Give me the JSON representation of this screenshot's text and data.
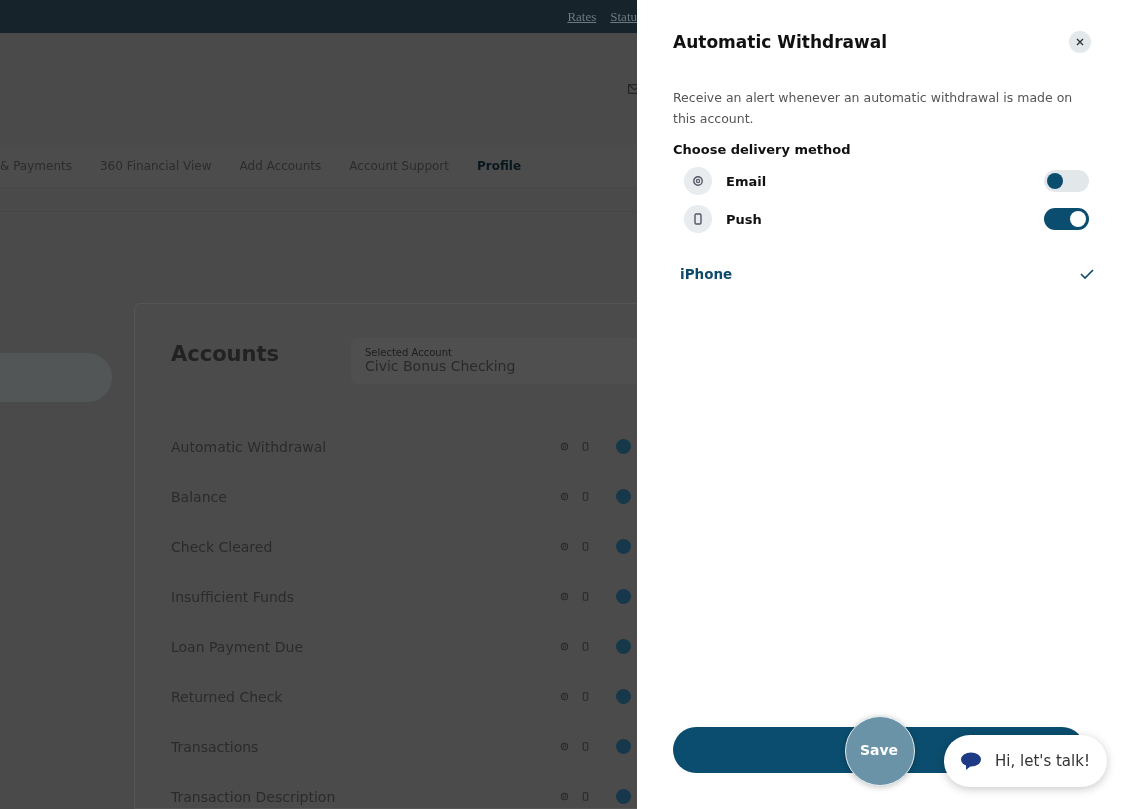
{
  "top_links": [
    "Rates",
    "Statu"
  ],
  "nav": [
    {
      "label": "& Payments",
      "selected": false
    },
    {
      "label": "360 Financial View",
      "selected": false
    },
    {
      "label": "Add Accounts",
      "selected": false
    },
    {
      "label": "Account Support",
      "selected": false
    },
    {
      "label": "Profile",
      "selected": true
    }
  ],
  "accounts": {
    "title": "Accounts",
    "selector": {
      "label": "Selected Account",
      "value": "Civic Bonus Checking"
    },
    "alerts": [
      "Automatic Withdrawal",
      "Balance",
      "Check Cleared",
      "Insufficient Funds",
      "Loan Payment Due",
      "Returned Check",
      "Transactions",
      "Transaction Description"
    ]
  },
  "panel": {
    "title": "Automatic Withdrawal",
    "description": "Receive an alert whenever an automatic withdrawal is made on this account.",
    "section": "Choose delivery method",
    "methods": [
      {
        "kind": "email",
        "label": "Email",
        "on": false
      },
      {
        "kind": "push",
        "label": "Push",
        "on": true
      }
    ],
    "devices": [
      {
        "label": "iPhone",
        "selected": true
      }
    ],
    "save": "Save"
  },
  "chat": {
    "label": "Hi, let's talk!"
  }
}
